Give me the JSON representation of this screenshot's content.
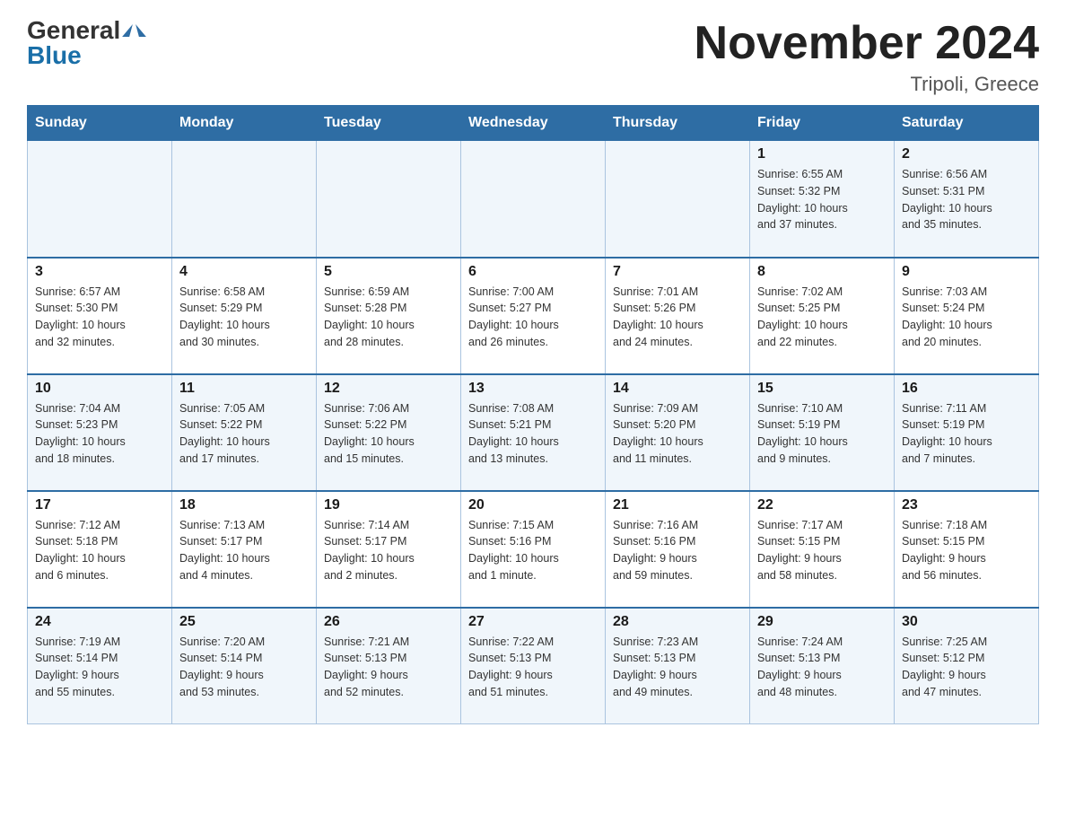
{
  "logo": {
    "general": "General",
    "blue": "Blue"
  },
  "title": "November 2024",
  "location": "Tripoli, Greece",
  "days_of_week": [
    "Sunday",
    "Monday",
    "Tuesday",
    "Wednesday",
    "Thursday",
    "Friday",
    "Saturday"
  ],
  "weeks": [
    [
      {
        "day": "",
        "info": ""
      },
      {
        "day": "",
        "info": ""
      },
      {
        "day": "",
        "info": ""
      },
      {
        "day": "",
        "info": ""
      },
      {
        "day": "",
        "info": ""
      },
      {
        "day": "1",
        "info": "Sunrise: 6:55 AM\nSunset: 5:32 PM\nDaylight: 10 hours\nand 37 minutes."
      },
      {
        "day": "2",
        "info": "Sunrise: 6:56 AM\nSunset: 5:31 PM\nDaylight: 10 hours\nand 35 minutes."
      }
    ],
    [
      {
        "day": "3",
        "info": "Sunrise: 6:57 AM\nSunset: 5:30 PM\nDaylight: 10 hours\nand 32 minutes."
      },
      {
        "day": "4",
        "info": "Sunrise: 6:58 AM\nSunset: 5:29 PM\nDaylight: 10 hours\nand 30 minutes."
      },
      {
        "day": "5",
        "info": "Sunrise: 6:59 AM\nSunset: 5:28 PM\nDaylight: 10 hours\nand 28 minutes."
      },
      {
        "day": "6",
        "info": "Sunrise: 7:00 AM\nSunset: 5:27 PM\nDaylight: 10 hours\nand 26 minutes."
      },
      {
        "day": "7",
        "info": "Sunrise: 7:01 AM\nSunset: 5:26 PM\nDaylight: 10 hours\nand 24 minutes."
      },
      {
        "day": "8",
        "info": "Sunrise: 7:02 AM\nSunset: 5:25 PM\nDaylight: 10 hours\nand 22 minutes."
      },
      {
        "day": "9",
        "info": "Sunrise: 7:03 AM\nSunset: 5:24 PM\nDaylight: 10 hours\nand 20 minutes."
      }
    ],
    [
      {
        "day": "10",
        "info": "Sunrise: 7:04 AM\nSunset: 5:23 PM\nDaylight: 10 hours\nand 18 minutes."
      },
      {
        "day": "11",
        "info": "Sunrise: 7:05 AM\nSunset: 5:22 PM\nDaylight: 10 hours\nand 17 minutes."
      },
      {
        "day": "12",
        "info": "Sunrise: 7:06 AM\nSunset: 5:22 PM\nDaylight: 10 hours\nand 15 minutes."
      },
      {
        "day": "13",
        "info": "Sunrise: 7:08 AM\nSunset: 5:21 PM\nDaylight: 10 hours\nand 13 minutes."
      },
      {
        "day": "14",
        "info": "Sunrise: 7:09 AM\nSunset: 5:20 PM\nDaylight: 10 hours\nand 11 minutes."
      },
      {
        "day": "15",
        "info": "Sunrise: 7:10 AM\nSunset: 5:19 PM\nDaylight: 10 hours\nand 9 minutes."
      },
      {
        "day": "16",
        "info": "Sunrise: 7:11 AM\nSunset: 5:19 PM\nDaylight: 10 hours\nand 7 minutes."
      }
    ],
    [
      {
        "day": "17",
        "info": "Sunrise: 7:12 AM\nSunset: 5:18 PM\nDaylight: 10 hours\nand 6 minutes."
      },
      {
        "day": "18",
        "info": "Sunrise: 7:13 AM\nSunset: 5:17 PM\nDaylight: 10 hours\nand 4 minutes."
      },
      {
        "day": "19",
        "info": "Sunrise: 7:14 AM\nSunset: 5:17 PM\nDaylight: 10 hours\nand 2 minutes."
      },
      {
        "day": "20",
        "info": "Sunrise: 7:15 AM\nSunset: 5:16 PM\nDaylight: 10 hours\nand 1 minute."
      },
      {
        "day": "21",
        "info": "Sunrise: 7:16 AM\nSunset: 5:16 PM\nDaylight: 9 hours\nand 59 minutes."
      },
      {
        "day": "22",
        "info": "Sunrise: 7:17 AM\nSunset: 5:15 PM\nDaylight: 9 hours\nand 58 minutes."
      },
      {
        "day": "23",
        "info": "Sunrise: 7:18 AM\nSunset: 5:15 PM\nDaylight: 9 hours\nand 56 minutes."
      }
    ],
    [
      {
        "day": "24",
        "info": "Sunrise: 7:19 AM\nSunset: 5:14 PM\nDaylight: 9 hours\nand 55 minutes."
      },
      {
        "day": "25",
        "info": "Sunrise: 7:20 AM\nSunset: 5:14 PM\nDaylight: 9 hours\nand 53 minutes."
      },
      {
        "day": "26",
        "info": "Sunrise: 7:21 AM\nSunset: 5:13 PM\nDaylight: 9 hours\nand 52 minutes."
      },
      {
        "day": "27",
        "info": "Sunrise: 7:22 AM\nSunset: 5:13 PM\nDaylight: 9 hours\nand 51 minutes."
      },
      {
        "day": "28",
        "info": "Sunrise: 7:23 AM\nSunset: 5:13 PM\nDaylight: 9 hours\nand 49 minutes."
      },
      {
        "day": "29",
        "info": "Sunrise: 7:24 AM\nSunset: 5:13 PM\nDaylight: 9 hours\nand 48 minutes."
      },
      {
        "day": "30",
        "info": "Sunrise: 7:25 AM\nSunset: 5:12 PM\nDaylight: 9 hours\nand 47 minutes."
      }
    ]
  ]
}
